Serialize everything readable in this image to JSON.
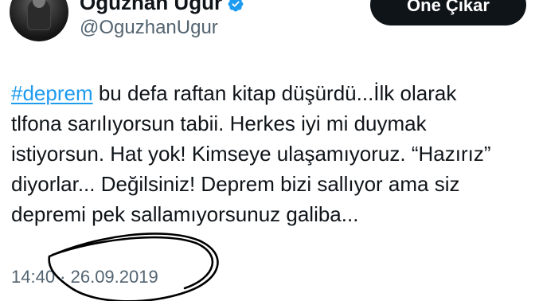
{
  "profile": {
    "display_name": "Oğuzhan Uğur",
    "handle": "@OguzhanUgur",
    "verified": true
  },
  "actions": {
    "highlight_label": "Öne Çıkar"
  },
  "tweet": {
    "hashtag": "#deprem",
    "text_after_hashtag": " bu defa raftan kitap düşürdü...İlk olarak\ntlfona sarılıyorsun tabii. Herkes iyi mi duymak\nistiyorsun. Hat yok! Kimseye ulaşamıyoruz. “Hazırız”\ndiyorlar... Değilsiniz! Deprem bizi sallıyor ama siz\ndepremi pek sallamıyorsunuz galiba...",
    "timestamp": "14:40 · 26.09.2019"
  },
  "colors": {
    "hashtag": "#1d9bf0",
    "verified_badge": "#1d9bf0",
    "button_bg": "#0f1419",
    "muted_text": "#536471",
    "annotation_ink": "#000000"
  },
  "icons": {
    "verified": "verified-badge-icon"
  }
}
